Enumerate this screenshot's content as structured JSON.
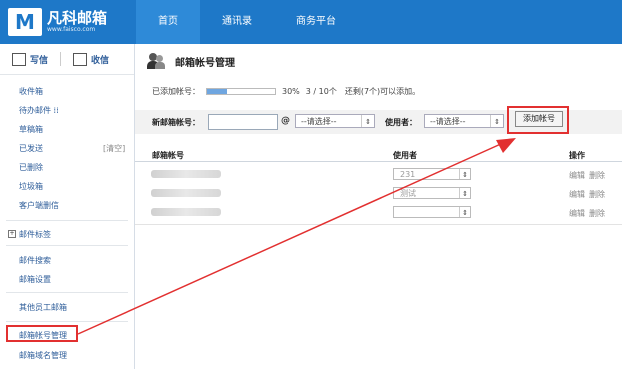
{
  "brand": {
    "logo_letter": "M",
    "name": "凡科邮箱",
    "url": "www.faisco.com"
  },
  "nav": {
    "items": [
      "首页",
      "通讯录",
      "商务平台"
    ]
  },
  "sidebar": {
    "compose": "写信",
    "inbox": "收信",
    "items": [
      "收件箱",
      "待办邮件 ⁞⁞",
      "草稿箱",
      "已发送",
      "已删除",
      "垃圾箱",
      "客户端删信"
    ],
    "sent_clear": "[清空]",
    "labels": "邮件标签",
    "search": "邮件搜索",
    "settings": "邮箱设置",
    "other": "其他员工邮箱",
    "account_mgmt": "邮箱帐号管理",
    "domain_mgmt": "邮箱域名管理"
  },
  "page": {
    "title": "邮箱帐号管理",
    "quota_label": "已添加帐号：",
    "quota_percent": "30%",
    "quota_count": "3 / 10个",
    "quota_hint": "还剩(7个)可以添加。",
    "quota_fill": 0.3
  },
  "form": {
    "new_account_label": "新邮箱帐号：",
    "at": "@",
    "domain_select": "--请选择--",
    "user_label": "使用者：",
    "user_select": "--请选择--",
    "add_button": "添加帐号"
  },
  "table": {
    "headers": [
      "邮箱帐号",
      "使用者",
      "操作"
    ],
    "rows": [
      {
        "user": "231",
        "edit": "编辑",
        "delete": "删除"
      },
      {
        "user": "测试",
        "edit": "编辑",
        "delete": "删除"
      },
      {
        "user": "",
        "edit": "编辑",
        "delete": "删除"
      }
    ]
  },
  "colors": {
    "accent": "#1e78c8",
    "highlight": "#e23030"
  }
}
